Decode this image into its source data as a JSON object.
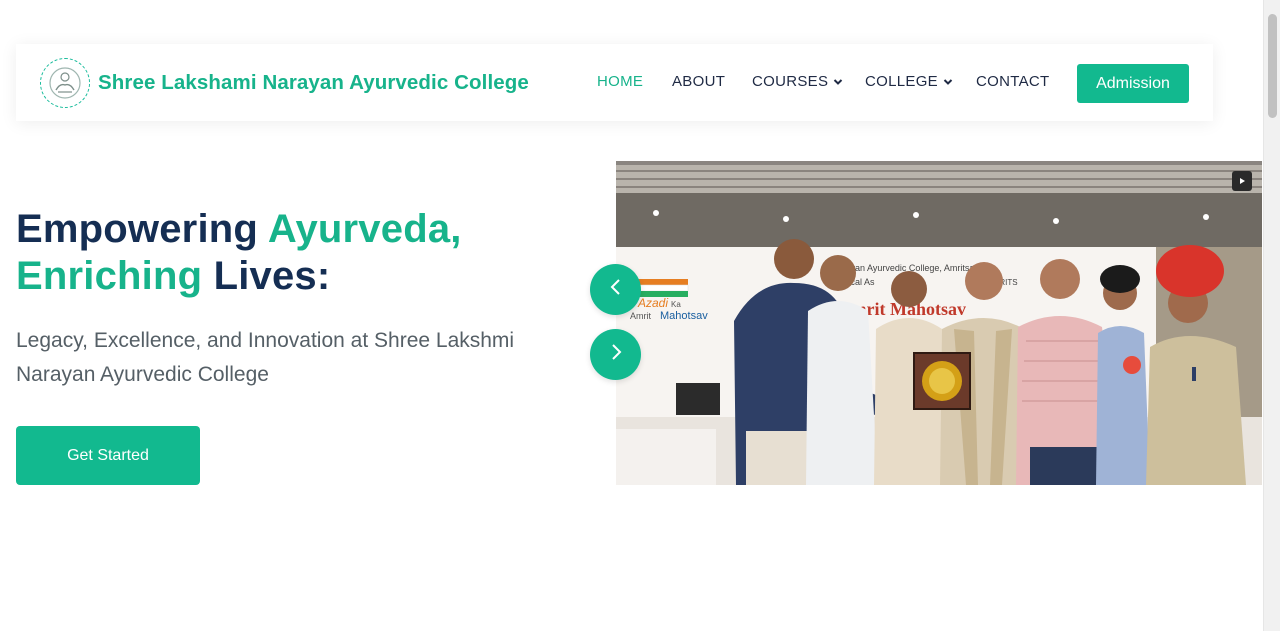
{
  "header": {
    "site_title": "Shree Lakshami Narayan Ayurvedic College",
    "logo_icon": "college-emblem-icon",
    "nav": [
      {
        "label": "HOME",
        "active": true
      },
      {
        "label": "ABOUT",
        "active": false
      },
      {
        "label": "COURSES",
        "active": false,
        "dropdown": true
      },
      {
        "label": "COLLEGE",
        "active": false,
        "dropdown": true
      },
      {
        "label": "CONTACT",
        "active": false
      }
    ],
    "admission_label": "Admission"
  },
  "hero": {
    "title_part1": "Empowering ",
    "title_accent1": "Ayurveda,",
    "title_accent2": "Enriching",
    "title_part2": " Lives:",
    "subtitle": "Legacy, Excellence, and Innovation at Shree Lakshmi Narayan Ayurvedic College",
    "cta_label": "Get Started"
  },
  "carousel": {
    "banner_line1": "Narayan Ayurvedic College, Amritsar",
    "banner_line2": "Medical As",
    "banner_line2b": "NIMA AMRITS",
    "banner_line3": "Azadi",
    "banner_line3b": "Ka",
    "banner_line4": "Amrit",
    "banner_line4b": "Mahotsav",
    "banner_big": "a Amrit Mahotsav",
    "prev_icon": "chevron-left-icon",
    "next_icon": "chevron-right-icon",
    "play_icon": "play-icon"
  },
  "colors": {
    "accent": "#12b98f",
    "navy": "#152e53"
  }
}
